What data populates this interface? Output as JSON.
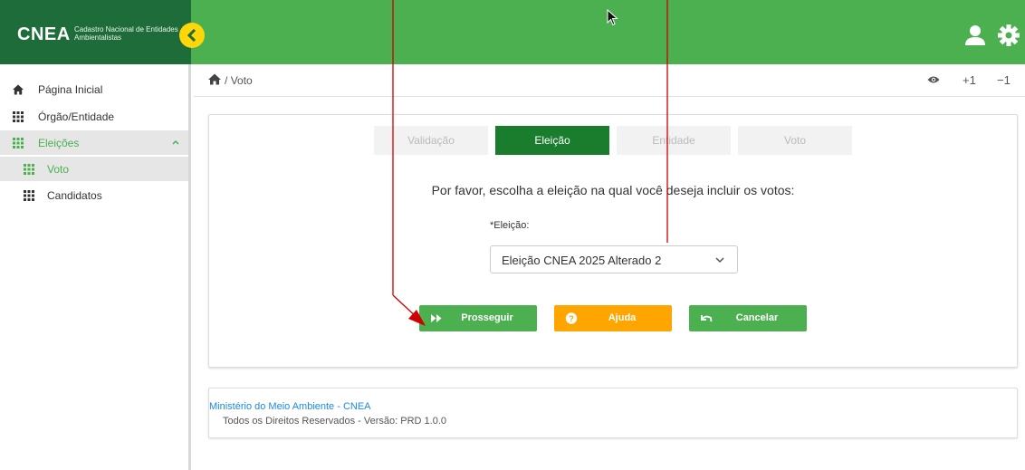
{
  "header": {
    "brand": "CNEA",
    "brand_sub": "Cadastro Nacional de Entidades Ambientalistas"
  },
  "sidebar": {
    "items": [
      {
        "label": "Página Inicial",
        "icon": "home-icon"
      },
      {
        "label": "Órgão/Entidade",
        "icon": "grid-icon"
      },
      {
        "label": "Eleições",
        "icon": "grid-icon",
        "expanded": true
      },
      {
        "label": "Voto",
        "icon": "grid-icon",
        "selected": true
      },
      {
        "label": "Candidatos",
        "icon": "grid-icon"
      }
    ]
  },
  "breadcrumb": {
    "separator": "/",
    "current": "Voto"
  },
  "zoom": {
    "plus": "+1",
    "minus": "−1"
  },
  "steps": [
    "Validação",
    "Eleição",
    "Entidade",
    "Voto"
  ],
  "active_step": "Eleição",
  "prompt": "Por favor, escolha a eleição na qual você deseja incluir os votos:",
  "election_field": {
    "label": "*Eleição:",
    "value": "Eleição CNEA 2025 Alterado 2"
  },
  "buttons": {
    "proceed": "Prosseguir",
    "help": "Ajuda",
    "cancel": "Cancelar"
  },
  "footer": {
    "link": "Ministério do Meio Ambiente - CNEA",
    "text": "Todos os Direitos Reservados - Versão: PRD 1.0.0"
  },
  "colors": {
    "primary_green": "#4caf50",
    "dark_green": "#1e6c3a",
    "step_active": "#197d2d",
    "help_orange": "#ffa500",
    "toggle_yellow": "#ffd60a",
    "link_blue": "#1e88e5",
    "annotation_red": "#d00000"
  }
}
